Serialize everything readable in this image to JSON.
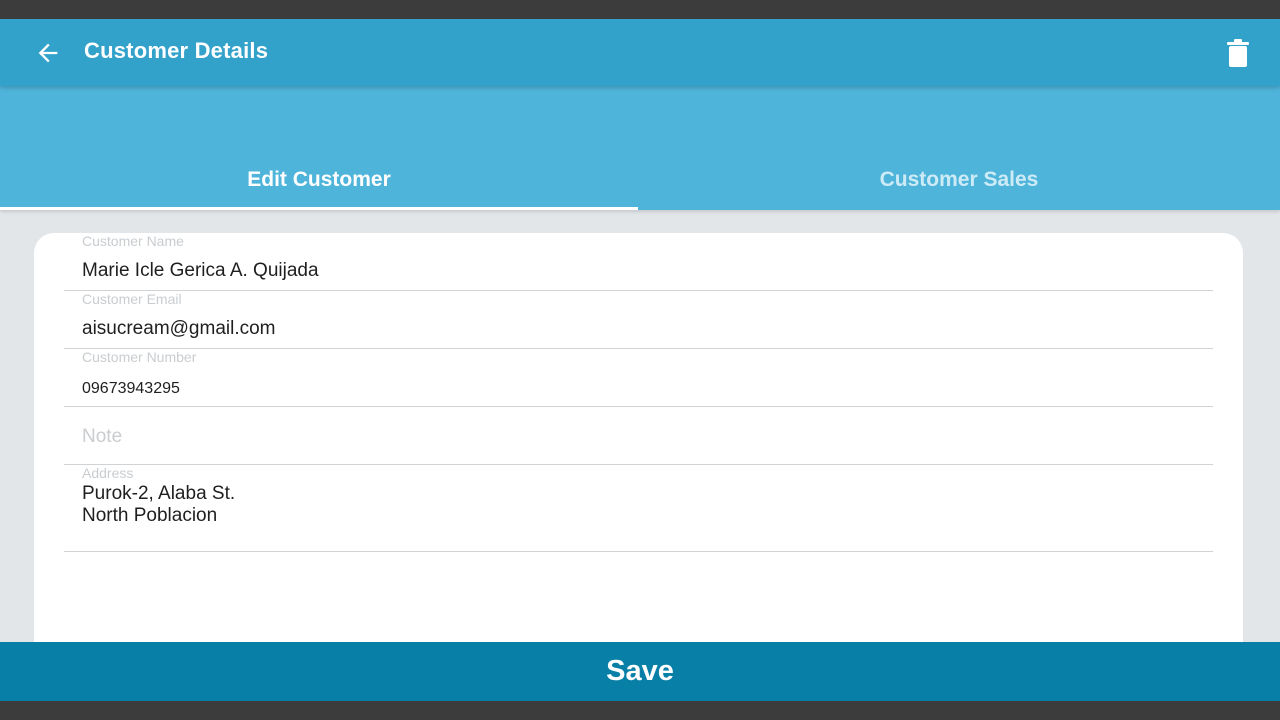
{
  "header": {
    "title": "Customer Details",
    "back_icon": "arrow-left-icon",
    "delete_icon": "trash-icon",
    "color": "#33a2cb"
  },
  "tabs": [
    {
      "label": "Edit Customer",
      "active": true
    },
    {
      "label": "Customer Sales",
      "active": false
    }
  ],
  "form": {
    "name": {
      "label": "Customer Name",
      "value": "Marie Icle Gerica A. Quijada"
    },
    "email": {
      "label": "Customer Email",
      "value": "aisucream@gmail.com"
    },
    "number": {
      "label": "Customer Number",
      "value": "09673943295"
    },
    "note": {
      "placeholder": "Note",
      "value": ""
    },
    "address": {
      "label": "Address",
      "value": "Purok-2, Alaba St.\nNorth Poblacion"
    }
  },
  "footer": {
    "save_label": "Save",
    "color": "#087fa6"
  }
}
